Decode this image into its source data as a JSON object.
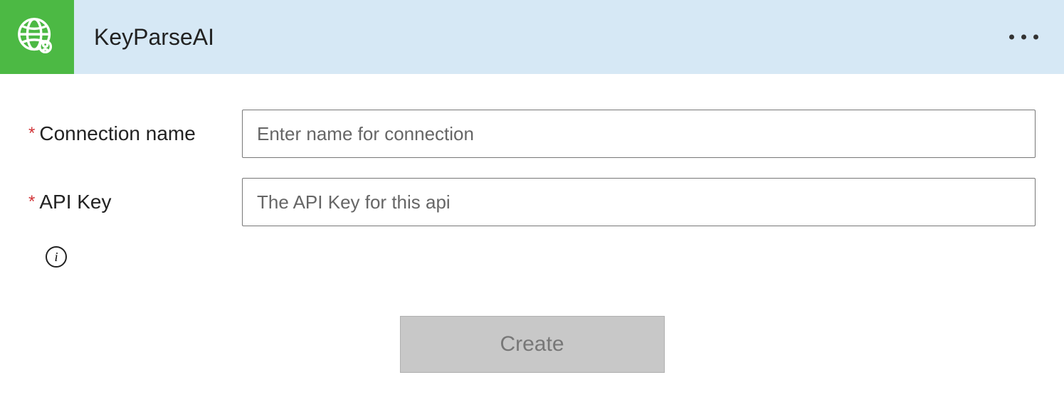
{
  "header": {
    "title": "KeyParseAI",
    "icon": "globe-search-icon",
    "accent_color": "#4cb944"
  },
  "form": {
    "fields": [
      {
        "label": "Connection name",
        "required": true,
        "placeholder": "Enter name for connection",
        "value": ""
      },
      {
        "label": "API Key",
        "required": true,
        "placeholder": "The API Key for this api",
        "value": ""
      }
    ],
    "info_icon": "info-icon"
  },
  "actions": {
    "create_label": "Create"
  }
}
